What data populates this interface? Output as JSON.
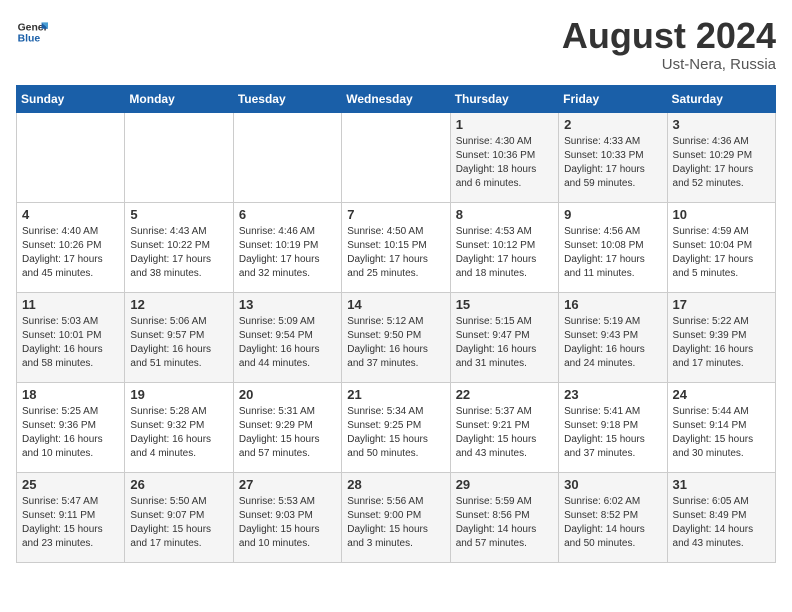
{
  "logo": {
    "general": "General",
    "blue": "Blue"
  },
  "title": {
    "month_year": "August 2024",
    "location": "Ust-Nera, Russia"
  },
  "days_of_week": [
    "Sunday",
    "Monday",
    "Tuesday",
    "Wednesday",
    "Thursday",
    "Friday",
    "Saturday"
  ],
  "weeks": [
    [
      {
        "day": "",
        "info": ""
      },
      {
        "day": "",
        "info": ""
      },
      {
        "day": "",
        "info": ""
      },
      {
        "day": "",
        "info": ""
      },
      {
        "day": "1",
        "info": "Sunrise: 4:30 AM\nSunset: 10:36 PM\nDaylight: 18 hours\nand 6 minutes."
      },
      {
        "day": "2",
        "info": "Sunrise: 4:33 AM\nSunset: 10:33 PM\nDaylight: 17 hours\nand 59 minutes."
      },
      {
        "day": "3",
        "info": "Sunrise: 4:36 AM\nSunset: 10:29 PM\nDaylight: 17 hours\nand 52 minutes."
      }
    ],
    [
      {
        "day": "4",
        "info": "Sunrise: 4:40 AM\nSunset: 10:26 PM\nDaylight: 17 hours\nand 45 minutes."
      },
      {
        "day": "5",
        "info": "Sunrise: 4:43 AM\nSunset: 10:22 PM\nDaylight: 17 hours\nand 38 minutes."
      },
      {
        "day": "6",
        "info": "Sunrise: 4:46 AM\nSunset: 10:19 PM\nDaylight: 17 hours\nand 32 minutes."
      },
      {
        "day": "7",
        "info": "Sunrise: 4:50 AM\nSunset: 10:15 PM\nDaylight: 17 hours\nand 25 minutes."
      },
      {
        "day": "8",
        "info": "Sunrise: 4:53 AM\nSunset: 10:12 PM\nDaylight: 17 hours\nand 18 minutes."
      },
      {
        "day": "9",
        "info": "Sunrise: 4:56 AM\nSunset: 10:08 PM\nDaylight: 17 hours\nand 11 minutes."
      },
      {
        "day": "10",
        "info": "Sunrise: 4:59 AM\nSunset: 10:04 PM\nDaylight: 17 hours\nand 5 minutes."
      }
    ],
    [
      {
        "day": "11",
        "info": "Sunrise: 5:03 AM\nSunset: 10:01 PM\nDaylight: 16 hours\nand 58 minutes."
      },
      {
        "day": "12",
        "info": "Sunrise: 5:06 AM\nSunset: 9:57 PM\nDaylight: 16 hours\nand 51 minutes."
      },
      {
        "day": "13",
        "info": "Sunrise: 5:09 AM\nSunset: 9:54 PM\nDaylight: 16 hours\nand 44 minutes."
      },
      {
        "day": "14",
        "info": "Sunrise: 5:12 AM\nSunset: 9:50 PM\nDaylight: 16 hours\nand 37 minutes."
      },
      {
        "day": "15",
        "info": "Sunrise: 5:15 AM\nSunset: 9:47 PM\nDaylight: 16 hours\nand 31 minutes."
      },
      {
        "day": "16",
        "info": "Sunrise: 5:19 AM\nSunset: 9:43 PM\nDaylight: 16 hours\nand 24 minutes."
      },
      {
        "day": "17",
        "info": "Sunrise: 5:22 AM\nSunset: 9:39 PM\nDaylight: 16 hours\nand 17 minutes."
      }
    ],
    [
      {
        "day": "18",
        "info": "Sunrise: 5:25 AM\nSunset: 9:36 PM\nDaylight: 16 hours\nand 10 minutes."
      },
      {
        "day": "19",
        "info": "Sunrise: 5:28 AM\nSunset: 9:32 PM\nDaylight: 16 hours\nand 4 minutes."
      },
      {
        "day": "20",
        "info": "Sunrise: 5:31 AM\nSunset: 9:29 PM\nDaylight: 15 hours\nand 57 minutes."
      },
      {
        "day": "21",
        "info": "Sunrise: 5:34 AM\nSunset: 9:25 PM\nDaylight: 15 hours\nand 50 minutes."
      },
      {
        "day": "22",
        "info": "Sunrise: 5:37 AM\nSunset: 9:21 PM\nDaylight: 15 hours\nand 43 minutes."
      },
      {
        "day": "23",
        "info": "Sunrise: 5:41 AM\nSunset: 9:18 PM\nDaylight: 15 hours\nand 37 minutes."
      },
      {
        "day": "24",
        "info": "Sunrise: 5:44 AM\nSunset: 9:14 PM\nDaylight: 15 hours\nand 30 minutes."
      }
    ],
    [
      {
        "day": "25",
        "info": "Sunrise: 5:47 AM\nSunset: 9:11 PM\nDaylight: 15 hours\nand 23 minutes."
      },
      {
        "day": "26",
        "info": "Sunrise: 5:50 AM\nSunset: 9:07 PM\nDaylight: 15 hours\nand 17 minutes."
      },
      {
        "day": "27",
        "info": "Sunrise: 5:53 AM\nSunset: 9:03 PM\nDaylight: 15 hours\nand 10 minutes."
      },
      {
        "day": "28",
        "info": "Sunrise: 5:56 AM\nSunset: 9:00 PM\nDaylight: 15 hours\nand 3 minutes."
      },
      {
        "day": "29",
        "info": "Sunrise: 5:59 AM\nSunset: 8:56 PM\nDaylight: 14 hours\nand 57 minutes."
      },
      {
        "day": "30",
        "info": "Sunrise: 6:02 AM\nSunset: 8:52 PM\nDaylight: 14 hours\nand 50 minutes."
      },
      {
        "day": "31",
        "info": "Sunrise: 6:05 AM\nSunset: 8:49 PM\nDaylight: 14 hours\nand 43 minutes."
      }
    ]
  ]
}
